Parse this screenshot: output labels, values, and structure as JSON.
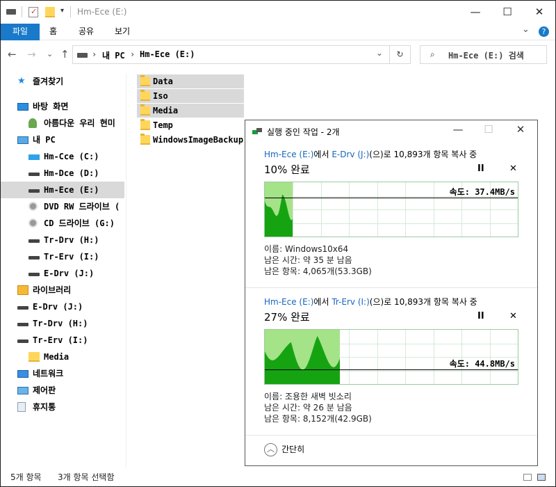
{
  "window": {
    "title": "Hm-Ece (E:)",
    "minimize": "—",
    "maximize": "☐",
    "close": "✕"
  },
  "ribbon": {
    "tabs": [
      "파일",
      "홈",
      "공유",
      "보기"
    ],
    "expand": "⌄",
    "help": "?"
  },
  "address": {
    "back": "←",
    "forward": "→",
    "recent": "⌄",
    "up": "↑",
    "path": [
      "내 PC",
      "Hm-Ece (E:)"
    ],
    "separator": "›",
    "dropdown": "⌄",
    "refresh": "↻",
    "search_placeholder": "Hm-Ece (E:) 검색"
  },
  "nav": [
    {
      "label": "즐겨찾기",
      "icon": "star-icon",
      "indent": 1
    },
    {
      "label": "바탕 화면",
      "icon": "desktop-icon",
      "indent": 1
    },
    {
      "label": "아름다운 우리 현미",
      "icon": "user-folder-icon",
      "indent": 2
    },
    {
      "label": "내 PC",
      "icon": "pc-icon",
      "indent": 1
    },
    {
      "label": "Hm-Cce (C:)",
      "icon": "windows-drive-icon",
      "indent": 2
    },
    {
      "label": "Hm-Dce (D:)",
      "icon": "drive-icon",
      "indent": 2
    },
    {
      "label": "Hm-Ece (E:)",
      "icon": "drive-icon",
      "indent": 2,
      "selected": true
    },
    {
      "label": "DVD RW 드라이브 (",
      "icon": "dvd-icon",
      "indent": 2
    },
    {
      "label": "CD 드라이브 (G:)",
      "icon": "cd-icon",
      "indent": 2
    },
    {
      "label": "Tr-Drv (H:)",
      "icon": "drive-icon",
      "indent": 2
    },
    {
      "label": "Tr-Erv (I:)",
      "icon": "drive-icon",
      "indent": 2
    },
    {
      "label": "E-Drv (J:)",
      "icon": "drive-icon",
      "indent": 2
    },
    {
      "label": "라이브러리",
      "icon": "library-icon",
      "indent": 1
    },
    {
      "label": "E-Drv (J:)",
      "icon": "drive-icon",
      "indent": 1
    },
    {
      "label": "Tr-Drv (H:)",
      "icon": "drive-icon",
      "indent": 1
    },
    {
      "label": "Tr-Erv (I:)",
      "icon": "drive-icon",
      "indent": 1
    },
    {
      "label": "Media",
      "icon": "folder-icon",
      "indent": 2
    },
    {
      "label": "네트워크",
      "icon": "network-icon",
      "indent": 1
    },
    {
      "label": "제어판",
      "icon": "control-panel-icon",
      "indent": 1
    },
    {
      "label": "휴지통",
      "icon": "recycle-bin-icon",
      "indent": 1
    }
  ],
  "files": [
    {
      "name": "Data",
      "selected": true
    },
    {
      "name": "Iso",
      "selected": true
    },
    {
      "name": "Media",
      "selected": true
    },
    {
      "name": "Temp",
      "selected": false
    },
    {
      "name": "WindowsImageBackup",
      "selected": false
    }
  ],
  "status": {
    "count": "5개 항목",
    "selected": "3개 항목 선택함"
  },
  "dialog": {
    "title": "실행 중인 작업 - 2개",
    "minimize": "—",
    "maximize": "☐",
    "close": "✕",
    "less_info": "간단히",
    "jobs": [
      {
        "src": "Hm-Ece (E:)",
        "mid": "에서 ",
        "dst": "E-Drv (J:)",
        "tail": "(으)로 10,893개 항목 복사 중",
        "percent_text": "10% 완료",
        "progress": 0.1,
        "speed": "속도: 37.4MB/s",
        "speed_level": 0.72,
        "pause": "II",
        "cancel": "✕",
        "name": "이름: Windows10x64",
        "time": "남은 시간: 약 35 분 남음",
        "items": "남은 항목: 4,065개(53.3GB)"
      },
      {
        "src": "Hm-Ece (E:)",
        "mid": "에서 ",
        "dst": "Tr-Erv (I:)",
        "tail": "(으)로 10,893개 항목 복사 중",
        "percent_text": "27% 완료",
        "progress": 0.27,
        "speed": "속도: 44.8MB/s",
        "speed_level": 0.22,
        "pause": "II",
        "cancel": "✕",
        "name": "이름: 조용한 새벽 빗소리",
        "time": "남은 시간: 약 26 분 남음",
        "items": "남은 항목: 8,152개(42.9GB)"
      }
    ]
  },
  "colors": {
    "accent": "#1979ca",
    "link": "#1565c0",
    "graph_fill": "#a4e388",
    "graph_curve": "#16a312"
  }
}
